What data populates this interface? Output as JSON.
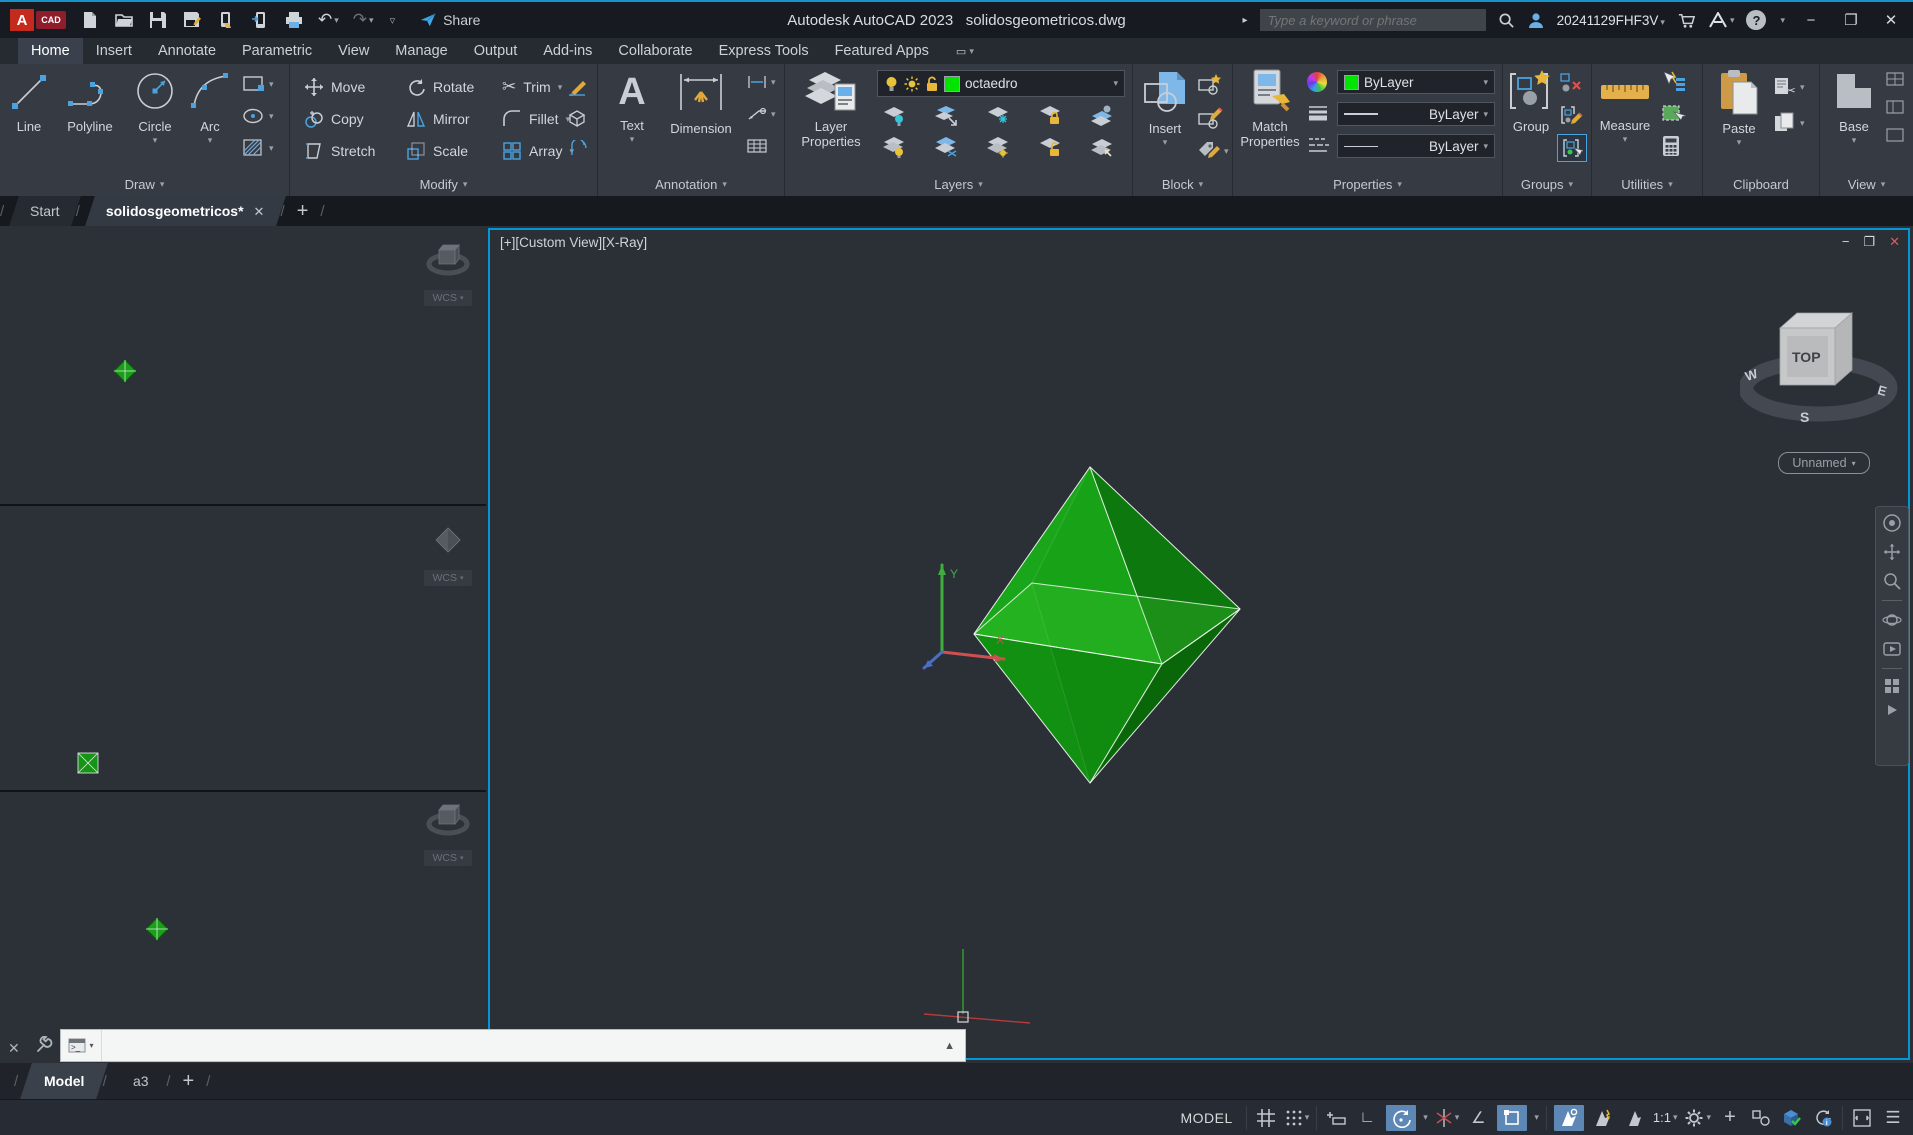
{
  "colors": {
    "accent_blue": "#0696d7",
    "layer_green": "#00e400",
    "octahedron_bright": "#1fb325",
    "octahedron_dark": "#0a6e0a",
    "status_highlight": "#5d87b4"
  },
  "icons": {
    "cv": "▾",
    "cu": "▲",
    "x": "✕",
    "min": "−",
    "max": "❐",
    "plus": "+",
    "sl": "/",
    "menu": "☰",
    "cut": "✂",
    "undo": "↶",
    "redo": "↷",
    "otrack": "∠",
    "ortho": "∟",
    "text_a": "A",
    "arrow": "▸",
    "q": "?"
  },
  "titlebar": {
    "app_title": "Autodesk AutoCAD 2023",
    "doc_title": "solidosgeometricos.dwg",
    "share": "Share",
    "search_placeholder": "Type a keyword or phrase",
    "account": "20241129FHF3V"
  },
  "ribbon": {
    "tabs": [
      "Home",
      "Insert",
      "Annotate",
      "Parametric",
      "View",
      "Manage",
      "Output",
      "Add-ins",
      "Collaborate",
      "Express Tools",
      "Featured Apps"
    ],
    "draw": {
      "label": "Draw",
      "line": "Line",
      "polyline": "Polyline",
      "circle": "Circle",
      "arc": "Arc"
    },
    "modify": {
      "label": "Modify",
      "move": "Move",
      "copy": "Copy",
      "stretch": "Stretch",
      "rotate": "Rotate",
      "mirror": "Mirror",
      "scale": "Scale",
      "trim": "Trim",
      "fillet": "Fillet",
      "array": "Array"
    },
    "annotation": {
      "label": "Annotation",
      "text": "Text",
      "dimension": "Dimension"
    },
    "layers": {
      "label": "Layers",
      "btn1": "Layer",
      "btn2": "Properties",
      "layer_name": "octaedro"
    },
    "block": {
      "label": "Block",
      "insert": "Insert"
    },
    "properties": {
      "label": "Properties",
      "match1": "Match",
      "match2": "Properties",
      "bylayer": "ByLayer"
    },
    "groups": {
      "label": "Groups",
      "group": "Group"
    },
    "utilities": {
      "label": "Utilities",
      "measure": "Measure"
    },
    "clipboard": {
      "label": "Clipboard",
      "paste": "Paste"
    },
    "view": {
      "label": "View",
      "base": "Base"
    }
  },
  "file_tabs": {
    "start": "Start",
    "active": "solidosgeometricos*"
  },
  "viewport": {
    "label": "[+][Custom View][X-Ray]",
    "cube_top": "TOP",
    "w": "W",
    "s": "S",
    "e": "E",
    "view_name": "Unnamed",
    "wcs": "WCS",
    "ucs_x": "X",
    "ucs_y": "Y"
  },
  "layout_tabs": {
    "model": "Model",
    "a3": "a3"
  },
  "status": {
    "model": "MODEL",
    "scale": "1:1"
  }
}
